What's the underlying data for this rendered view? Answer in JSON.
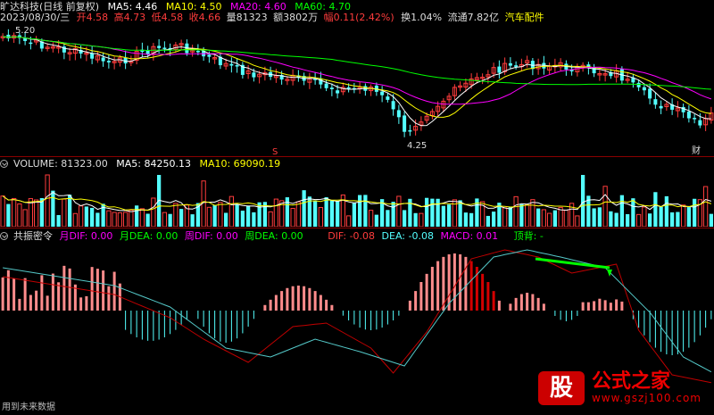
{
  "stock": {
    "name": "旷达科技",
    "mode": "(日线 前复权)",
    "ma5": "MA5: 4.46",
    "ma10": "MA10: 4.50",
    "ma20": "MA20: 4.60",
    "ma60": "MA60: 4.70",
    "date": "2023/08/30/三",
    "open": "开4.58",
    "high": "高4.73",
    "low": "低4.58",
    "close": "收4.66",
    "volume": "量81323",
    "amount": "额3802万",
    "change": "幅0.11(2.42%)",
    "turnover": "换1.04%",
    "float": "流通7.82亿",
    "sector": "汽车配件",
    "peak_label": "5.20",
    "trough_label": "4.25",
    "marker_s": "S",
    "marker_cai": "财",
    "colors": {
      "ma5": "#ffffff",
      "ma10": "#ffff00",
      "ma20": "#ff00ff",
      "ma60": "#00ff00",
      "up": "#ff3c3c",
      "down": "#54ffff"
    }
  },
  "volume_panel": {
    "label": "VOLUME: 81323.00",
    "ma5": "MA5: 84250.13",
    "ma10": "MA10: 69090.19"
  },
  "indicator": {
    "name": "共振密令",
    "m_dif": "月DIF: 0.00",
    "m_dea": "月DEA: 0.00",
    "w_dif": "周DIF: 0.00",
    "w_dea": "周DEA: 0.00",
    "dif": "DIF: -0.08",
    "dea": "DEA: -0.08",
    "macd": "MACD: 0.01",
    "top_div": "顶背: -",
    "footer": "用到未来数据"
  },
  "watermark": {
    "logo_char": "股",
    "text": "公式之家",
    "site": "www.gszj100.com"
  }
}
